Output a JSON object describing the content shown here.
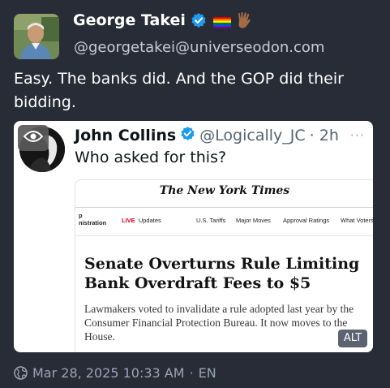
{
  "author": {
    "display_name": "George Takei",
    "handle": "@georgetakei@universeodon.com"
  },
  "post": {
    "text": "Easy. The banks did. And the GOP did their bidding."
  },
  "quoted": {
    "name": "John Collins",
    "handle": "@Logically_JC",
    "time": "· 2h",
    "more": "···",
    "text": "Who asked for this?",
    "alt_label": "ALT",
    "article": {
      "masthead": "The New York Times",
      "section_line1": "p",
      "section_line2": "nistration",
      "live_label": "LIVE",
      "live_text": "Updates",
      "nav_items": [
        "U.S. Tariffs",
        "Major Moves",
        "Approval Ratings",
        "What Voters"
      ],
      "headline": "Senate Overturns Rule Limiting Bank Overdraft Fees to $5",
      "dek": "Lawmakers voted to invalidate a rule adopted last year by the Consumer Financial Protection Bureau. It now moves to the House."
    }
  },
  "footer": {
    "timestamp": "Mar 28, 2025 10:33 AM",
    "separator": "·",
    "language": "EN"
  },
  "colors": {
    "background": "#282c37",
    "verified_badge": "#1d9bf0",
    "muted_text": "#9ba3b4",
    "live_red": "#d0021b"
  },
  "icons": [
    "verified-badge-icon",
    "rainbow-flag-icon",
    "vulcan-salute-icon",
    "eye-icon",
    "globe-icon"
  ]
}
